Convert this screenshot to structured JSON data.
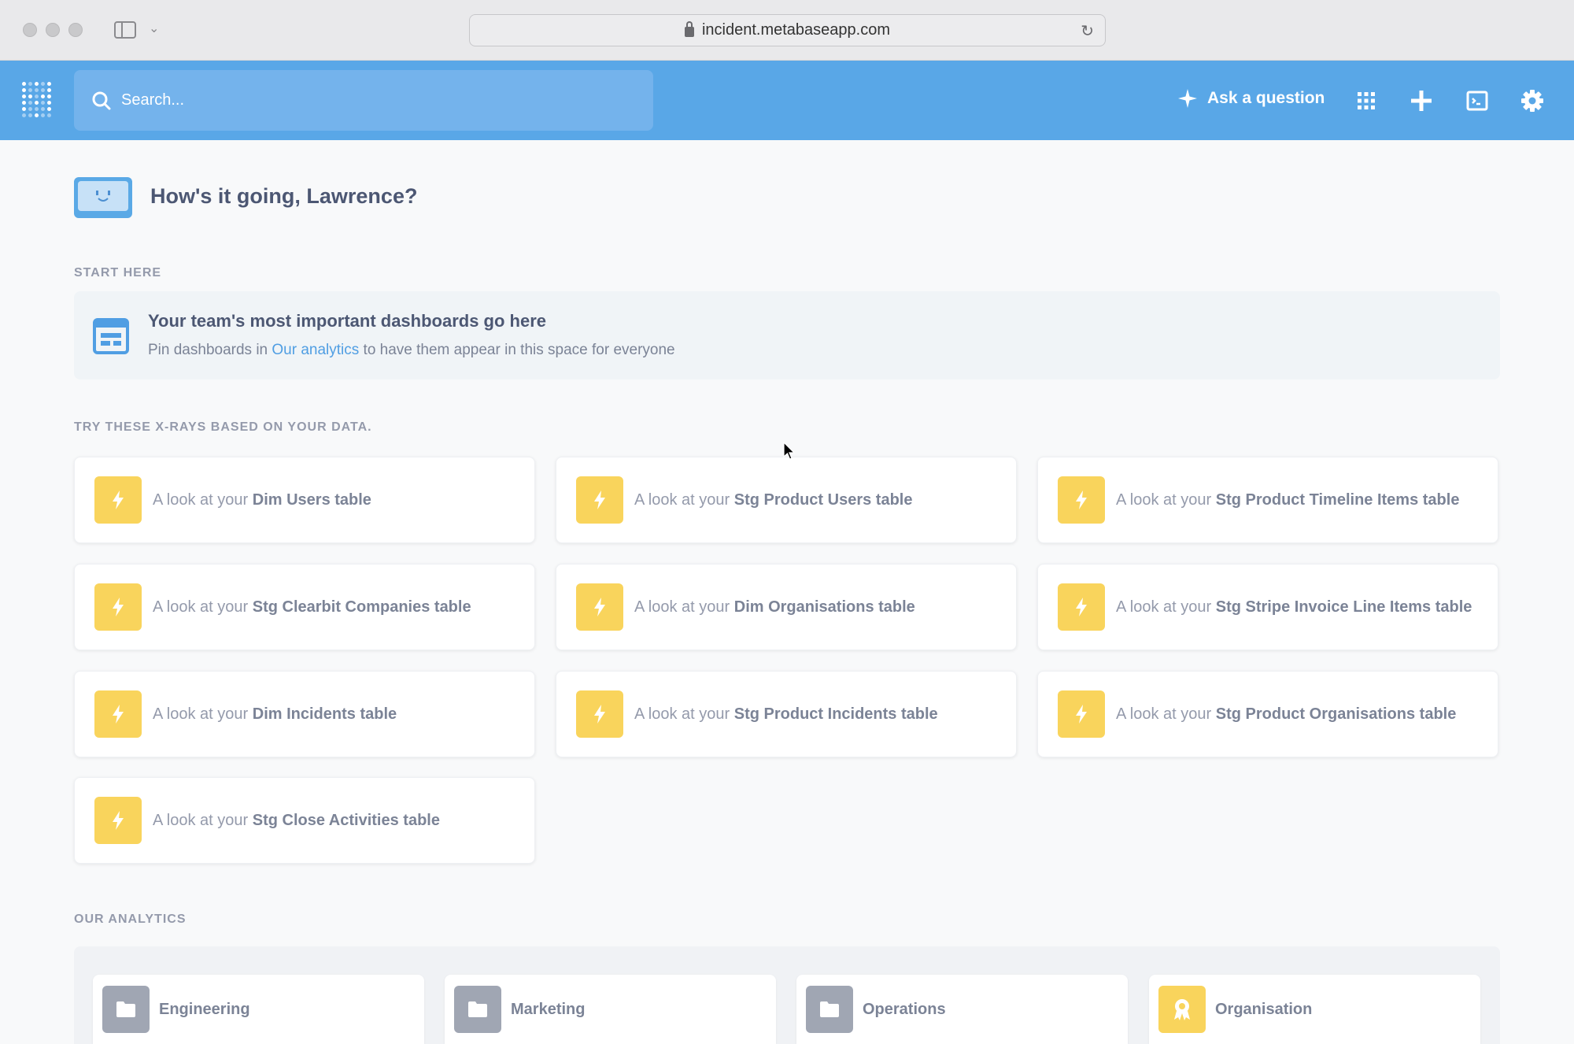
{
  "browser": {
    "url": "incident.metabaseapp.com"
  },
  "nav": {
    "search_placeholder": "Search...",
    "ask_label": "Ask a question",
    "icons": [
      "grid-icon",
      "plus-icon",
      "terminal-icon",
      "gear-icon"
    ]
  },
  "greeting": "How's it going, Lawrence?",
  "start_here": {
    "label": "START HERE",
    "title": "Your team's most important dashboards go here",
    "sub_prefix": "Pin dashboards in ",
    "sub_link": "Our analytics",
    "sub_suffix": " to have them appear in this space for everyone"
  },
  "xrays": {
    "label": "TRY THESE X-RAYS BASED ON YOUR DATA.",
    "prefix": "A look at your ",
    "items": [
      "Dim Users table",
      "Stg Product Users table",
      "Stg Product Timeline Items table",
      "Stg Clearbit Companies table",
      "Dim Organisations table",
      "Stg Stripe Invoice Line Items table",
      "Dim Incidents table",
      "Stg Product Incidents table",
      "Stg Product Organisations table",
      "Stg Close Activities table"
    ]
  },
  "our_analytics": {
    "label": "OUR ANALYTICS",
    "collections": [
      {
        "name": "Engineering",
        "icon": "folder-icon"
      },
      {
        "name": "Marketing",
        "icon": "folder-icon"
      },
      {
        "name": "Operations",
        "icon": "folder-icon"
      },
      {
        "name": "Organisation",
        "icon": "badge-icon"
      }
    ]
  },
  "colors": {
    "brand": "#509ee3",
    "nav_bg": "#59a7e7",
    "xray_yellow": "#f9d45c",
    "text_dark": "#4c5773",
    "text_muted": "#949aab"
  }
}
